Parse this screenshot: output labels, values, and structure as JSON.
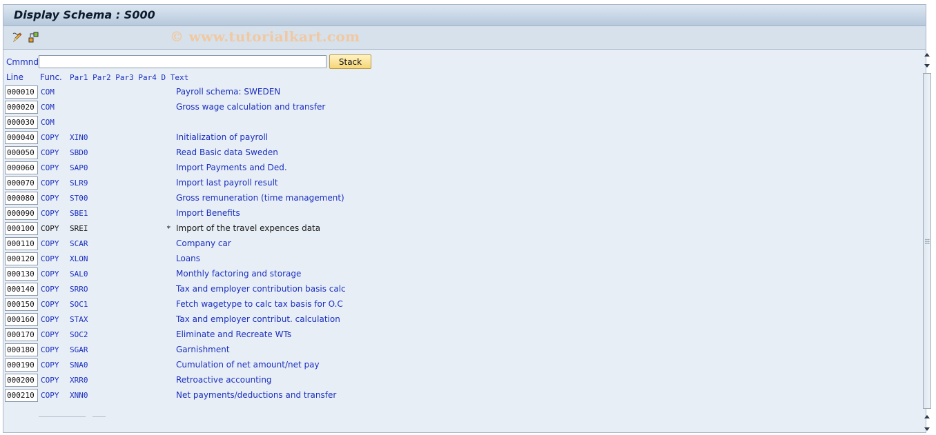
{
  "window": {
    "title": "Display Schema : S000",
    "watermark": "© www.tutorialkart.com"
  },
  "toolbar": {
    "icons": [
      "display-change-icon",
      "structure-icon"
    ]
  },
  "command": {
    "label": "Cmmnd",
    "value": "",
    "placeholder": "",
    "stack_button": "Stack"
  },
  "table": {
    "headers": {
      "line": "Line",
      "func": "Func.",
      "pars": "Par1 Par2 Par3 Par4 D Text"
    },
    "rows": [
      {
        "line": "000010",
        "func": "COM",
        "par1": "",
        "d": "",
        "text": "Payroll schema: SWEDEN",
        "active": true
      },
      {
        "line": "000020",
        "func": "COM",
        "par1": "",
        "d": "",
        "text": "Gross wage calculation and transfer",
        "active": true
      },
      {
        "line": "000030",
        "func": "COM",
        "par1": "",
        "d": "",
        "text": "",
        "active": true
      },
      {
        "line": "000040",
        "func": "COPY",
        "par1": "XIN0",
        "d": "",
        "text": "Initialization of payroll",
        "active": true
      },
      {
        "line": "000050",
        "func": "COPY",
        "par1": "SBD0",
        "d": "",
        "text": "Read Basic data Sweden",
        "active": true
      },
      {
        "line": "000060",
        "func": "COPY",
        "par1": "SAP0",
        "d": "",
        "text": "Import Payments and Ded.",
        "active": true
      },
      {
        "line": "000070",
        "func": "COPY",
        "par1": "SLR9",
        "d": "",
        "text": "Import last payroll result",
        "active": true
      },
      {
        "line": "000080",
        "func": "COPY",
        "par1": "ST00",
        "d": "",
        "text": "Gross remuneration (time management)",
        "active": true
      },
      {
        "line": "000090",
        "func": "COPY",
        "par1": "SBE1",
        "d": "",
        "text": "Import Benefits",
        "active": true
      },
      {
        "line": "000100",
        "func": "COPY",
        "par1": "SREI",
        "d": "*",
        "text": "Import of the travel expences data",
        "active": false
      },
      {
        "line": "000110",
        "func": "COPY",
        "par1": "SCAR",
        "d": "",
        "text": "Company car",
        "active": true
      },
      {
        "line": "000120",
        "func": "COPY",
        "par1": "XLON",
        "d": "",
        "text": "Loans",
        "active": true
      },
      {
        "line": "000130",
        "func": "COPY",
        "par1": "SAL0",
        "d": "",
        "text": "Monthly factoring and storage",
        "active": true
      },
      {
        "line": "000140",
        "func": "COPY",
        "par1": "SRRO",
        "d": "",
        "text": "Tax and employer contribution basis calc",
        "active": true
      },
      {
        "line": "000150",
        "func": "COPY",
        "par1": "SOC1",
        "d": "",
        "text": "Fetch wagetype to calc tax basis for O.C",
        "active": true
      },
      {
        "line": "000160",
        "func": "COPY",
        "par1": "STAX",
        "d": "",
        "text": "Tax and employer contribut. calculation",
        "active": true
      },
      {
        "line": "000170",
        "func": "COPY",
        "par1": "SOC2",
        "d": "",
        "text": "Eliminate and Recreate WTs",
        "active": true
      },
      {
        "line": "000180",
        "func": "COPY",
        "par1": "SGAR",
        "d": "",
        "text": "Garnishment",
        "active": true
      },
      {
        "line": "000190",
        "func": "COPY",
        "par1": "SNA0",
        "d": "",
        "text": "Cumulation of net amount/net pay",
        "active": true
      },
      {
        "line": "000200",
        "func": "COPY",
        "par1": "XRR0",
        "d": "",
        "text": "Retroactive accounting",
        "active": true
      },
      {
        "line": "000210",
        "func": "COPY",
        "par1": "XNN0",
        "d": "",
        "text": "Net payments/deductions and transfer",
        "active": true
      }
    ]
  }
}
